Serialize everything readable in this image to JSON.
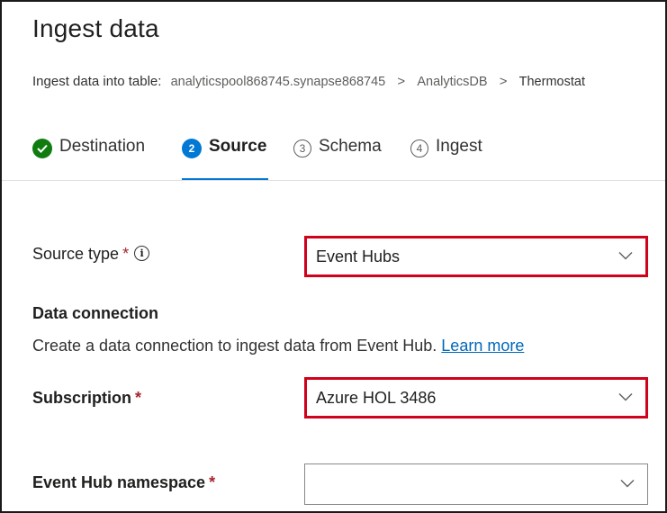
{
  "header": {
    "title": "Ingest data",
    "breadcrumb_prefix": "Ingest data into table:",
    "crumbs": [
      "analyticspool868745.synapse868745",
      "AnalyticsDB",
      "Thermostat"
    ],
    "separator": ">"
  },
  "steps": [
    {
      "number": "✔",
      "label": "Destination",
      "state": "done"
    },
    {
      "number": "2",
      "label": "Source",
      "state": "active"
    },
    {
      "number": "3",
      "label": "Schema",
      "state": "todo"
    },
    {
      "number": "4",
      "label": "Ingest",
      "state": "todo"
    }
  ],
  "form": {
    "source_type": {
      "label": "Source type",
      "required": "*",
      "info": "i",
      "value": "Event Hubs"
    },
    "data_connection": {
      "heading": "Data connection",
      "description": "Create a data connection to ingest data from Event Hub.",
      "learn_more": "Learn more"
    },
    "subscription": {
      "label": "Subscription",
      "required": "*",
      "value": "Azure HOL 3486"
    },
    "namespace": {
      "label": "Event Hub namespace",
      "required": "*",
      "value": ""
    }
  },
  "colors": {
    "accent": "#0078d4",
    "done": "#107c10",
    "highlight": "#d0021b",
    "link": "#0067b8"
  },
  "icons": {
    "chevron": "chevron-down-icon",
    "info": "info-icon",
    "check": "checkmark-icon"
  }
}
